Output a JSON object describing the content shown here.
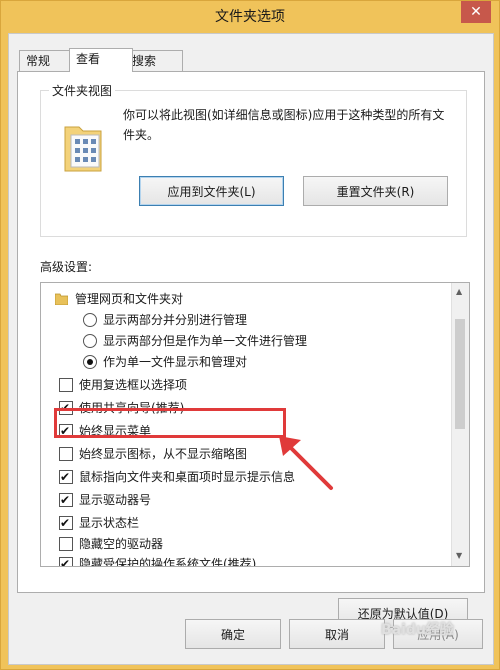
{
  "window": {
    "title": "文件夹选项",
    "close_icon": "close-icon"
  },
  "tabs": [
    {
      "label": "常规"
    },
    {
      "label": "查看"
    },
    {
      "label": "搜索"
    }
  ],
  "folder_view": {
    "group_title": "文件夹视图",
    "description": "你可以将此视图(如详细信息或图标)应用于这种类型的所有文件夹。",
    "apply_button": "应用到文件夹(L)",
    "reset_button": "重置文件夹(R)"
  },
  "advanced": {
    "label": "高级设置:",
    "items": [
      {
        "type": "folder",
        "label": "管理网页和文件夹对"
      },
      {
        "type": "radio",
        "checked": false,
        "label": "显示两部分并分别进行管理"
      },
      {
        "type": "radio",
        "checked": false,
        "label": "显示两部分但是作为单一文件进行管理"
      },
      {
        "type": "radio",
        "checked": true,
        "label": "作为单一文件显示和管理对"
      },
      {
        "type": "checkbox",
        "checked": false,
        "label": "使用复选框以选择项"
      },
      {
        "type": "checkbox",
        "checked": true,
        "label": "使用共享向导(推荐)"
      },
      {
        "type": "checkbox",
        "checked": true,
        "label": "始终显示菜单"
      },
      {
        "type": "checkbox",
        "checked": false,
        "label": "始终显示图标，从不显示缩略图"
      },
      {
        "type": "checkbox",
        "checked": true,
        "label": "鼠标指向文件夹和桌面项时显示提示信息"
      },
      {
        "type": "checkbox",
        "checked": true,
        "label": "显示驱动器号"
      },
      {
        "type": "checkbox",
        "checked": true,
        "label": "显示状态栏"
      },
      {
        "type": "checkbox",
        "checked": false,
        "label": "隐藏空的驱动器"
      },
      {
        "type": "checkbox",
        "checked": true,
        "label": "隐藏受保护的操作系统文件(推荐)"
      }
    ],
    "restore_button": "还原为默认值(D)"
  },
  "footer": {
    "ok_button": "确定",
    "cancel_button": "取消",
    "apply_button": "应用(A)"
  },
  "watermark": "Baidu经验",
  "colors": {
    "frame": "#f0c35a",
    "close": "#c7584b",
    "highlight": "#e03a3a"
  }
}
